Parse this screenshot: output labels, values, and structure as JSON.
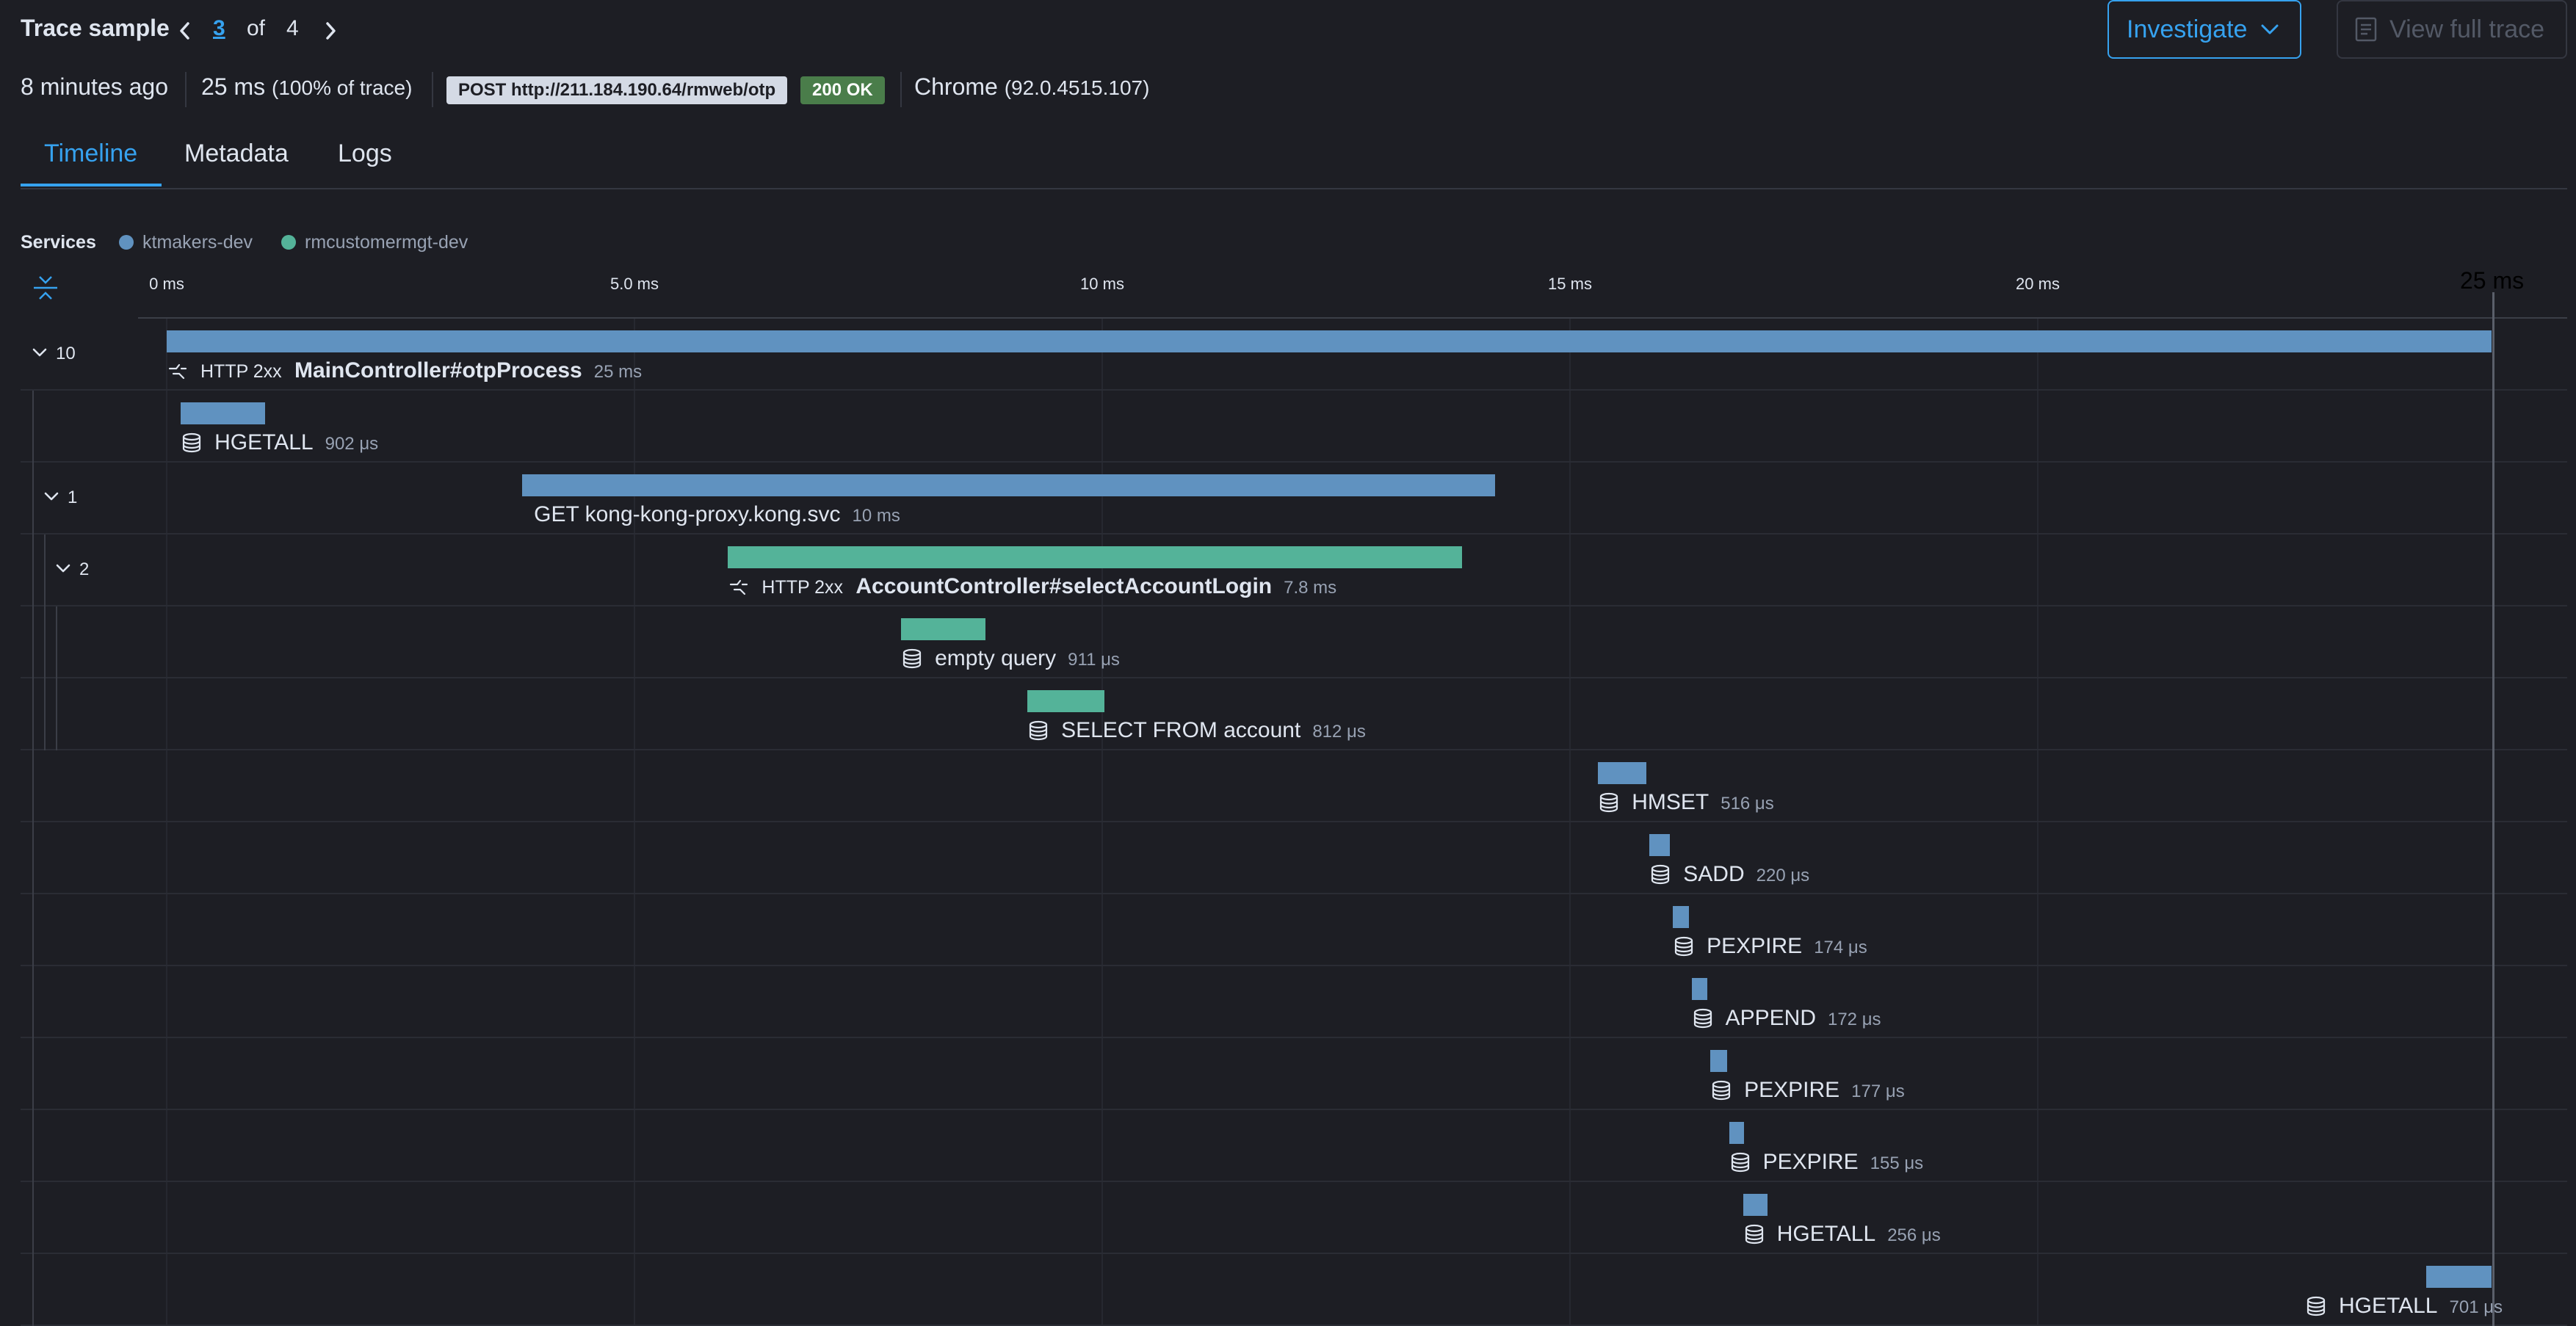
{
  "header": {
    "title": "Trace sample",
    "page_current": "3",
    "page_of": "of",
    "page_total": "4",
    "investigate_label": "Investigate",
    "view_full_label": "View full trace"
  },
  "summary": {
    "time_ago": "8 minutes ago",
    "duration": "25 ms",
    "duration_pct": "(100% of trace)",
    "request": "POST http://211.184.190.64/rmweb/otp",
    "status": "200 OK",
    "browser": "Chrome",
    "browser_version": "(92.0.4515.107)"
  },
  "tabs": [
    {
      "label": "Timeline",
      "active": true
    },
    {
      "label": "Metadata",
      "active": false
    },
    {
      "label": "Logs",
      "active": false
    }
  ],
  "legend": {
    "label": "Services",
    "items": [
      {
        "name": "ktmakers-dev",
        "color": "#6092c0"
      },
      {
        "name": "rmcustomermgt-dev",
        "color": "#54b399"
      }
    ]
  },
  "axis": {
    "ticks": [
      "0 ms",
      "5.0 ms",
      "10 ms",
      "15 ms",
      "20 ms"
    ],
    "tick_values_ms": [
      0,
      5,
      10,
      15,
      20
    ],
    "end_label": "25 ms",
    "max_ms": 24.85
  },
  "colors": {
    "ktmakers": "#6092c0",
    "rmcustomermgt": "#54b399",
    "accent": "#36a2ef",
    "status_ok": "#4a7d4a"
  },
  "spans": [
    {
      "service": "ktmakers-dev",
      "start_ms": 0.0,
      "dur_ms": 24.85,
      "kind": "http",
      "http": "HTTP 2xx",
      "name": "MainController#otpProcess",
      "duration": "25 ms",
      "collapse_count": "10",
      "depth": 0
    },
    {
      "service": "ktmakers-dev",
      "start_ms": 0.15,
      "dur_ms": 0.9,
      "kind": "db",
      "name": "HGETALL",
      "duration": "902 μs",
      "depth": 1
    },
    {
      "service": "ktmakers-dev",
      "start_ms": 3.8,
      "dur_ms": 10.4,
      "kind": "ext",
      "name": "GET kong-kong-proxy.kong.svc",
      "duration": "10 ms",
      "collapse_count": "1",
      "depth": 1
    },
    {
      "service": "rmcustomermgt-dev",
      "start_ms": 6.0,
      "dur_ms": 7.85,
      "kind": "http",
      "http": "HTTP 2xx",
      "name": "AccountController#selectAccountLogin",
      "duration": "7.8 ms",
      "collapse_count": "2",
      "depth": 2
    },
    {
      "service": "rmcustomermgt-dev",
      "start_ms": 7.85,
      "dur_ms": 0.9,
      "kind": "db",
      "name": "empty query",
      "duration": "911 μs",
      "depth": 3
    },
    {
      "service": "rmcustomermgt-dev",
      "start_ms": 9.2,
      "dur_ms": 0.82,
      "kind": "db",
      "name": "SELECT FROM account",
      "duration": "812 μs",
      "depth": 3
    },
    {
      "service": "ktmakers-dev",
      "start_ms": 15.3,
      "dur_ms": 0.52,
      "kind": "db",
      "name": "HMSET",
      "duration": "516 μs",
      "depth": 1
    },
    {
      "service": "ktmakers-dev",
      "start_ms": 15.85,
      "dur_ms": 0.22,
      "kind": "db",
      "name": "SADD",
      "duration": "220 μs",
      "depth": 1
    },
    {
      "service": "ktmakers-dev",
      "start_ms": 16.1,
      "dur_ms": 0.17,
      "kind": "db",
      "name": "PEXPIRE",
      "duration": "174 μs",
      "depth": 1
    },
    {
      "service": "ktmakers-dev",
      "start_ms": 16.3,
      "dur_ms": 0.17,
      "kind": "db",
      "name": "APPEND",
      "duration": "172 μs",
      "depth": 1
    },
    {
      "service": "ktmakers-dev",
      "start_ms": 16.5,
      "dur_ms": 0.18,
      "kind": "db",
      "name": "PEXPIRE",
      "duration": "177 μs",
      "depth": 1
    },
    {
      "service": "ktmakers-dev",
      "start_ms": 16.7,
      "dur_ms": 0.16,
      "kind": "db",
      "name": "PEXPIRE",
      "duration": "155 μs",
      "depth": 1
    },
    {
      "service": "ktmakers-dev",
      "start_ms": 16.85,
      "dur_ms": 0.26,
      "kind": "db",
      "name": "HGETALL",
      "duration": "256 μs",
      "depth": 1
    },
    {
      "service": "ktmakers-dev",
      "start_ms": 24.15,
      "dur_ms": 0.7,
      "kind": "db",
      "name": "HGETALL",
      "duration": "701 μs",
      "depth": 1
    }
  ]
}
